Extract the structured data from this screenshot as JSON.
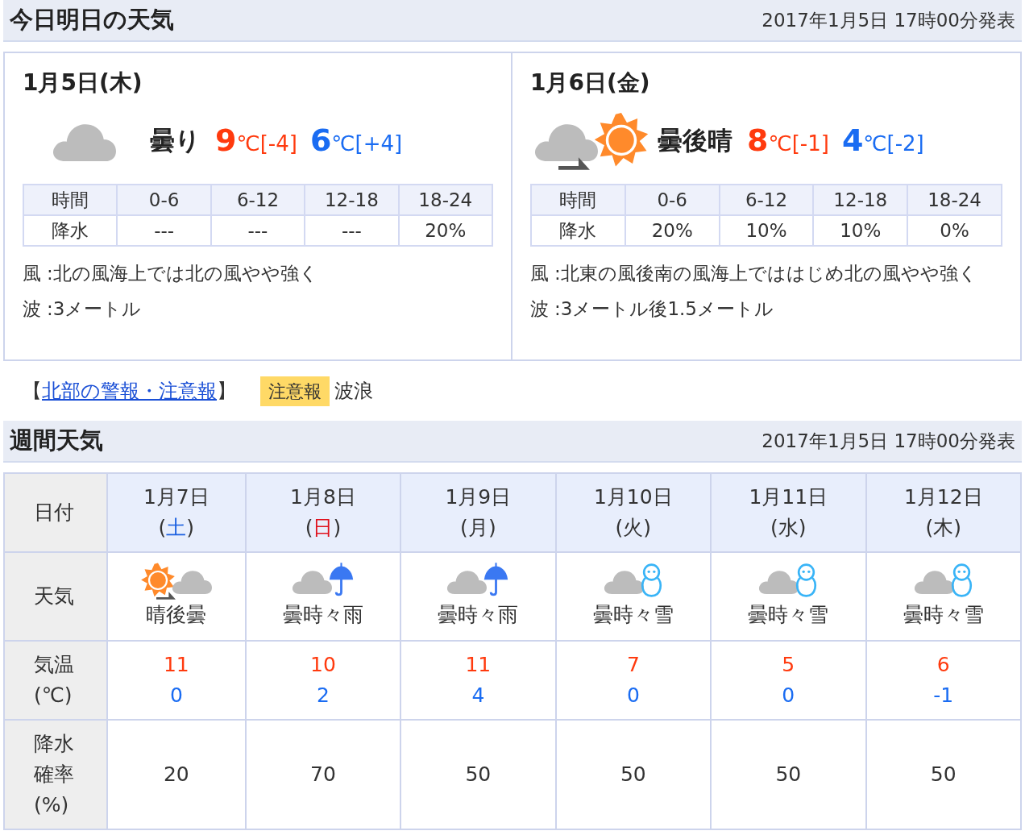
{
  "today_section": {
    "title": "今日明日の天気",
    "issued": "2017年1月5日 17時00分発表",
    "days": [
      {
        "date": "1月5日(木)",
        "icon": {
          "parts": [
            {
              "kind": "cloud"
            }
          ],
          "later": false
        },
        "weather": "曇り",
        "high": {
          "value": "9",
          "unit": "℃",
          "diff": "[-4]"
        },
        "low": {
          "value": "6",
          "unit": "℃",
          "diff": "[+4]"
        },
        "time_header": [
          "時間",
          "0-6",
          "6-12",
          "12-18",
          "18-24"
        ],
        "rain_row": [
          "降水",
          "---",
          "---",
          "---",
          "20%"
        ],
        "notes": [
          {
            "label": "風",
            "text": ":北の風海上では北の風やや強く"
          },
          {
            "label": "波",
            "text": ":3メートル"
          }
        ]
      },
      {
        "date": "1月6日(金)",
        "icon": {
          "parts": [
            {
              "kind": "cloud"
            },
            {
              "kind": "sun"
            }
          ],
          "later": true
        },
        "weather": "曇後晴",
        "high": {
          "value": "8",
          "unit": "℃",
          "diff": "[-1]"
        },
        "low": {
          "value": "4",
          "unit": "℃",
          "diff": "[-2]"
        },
        "time_header": [
          "時間",
          "0-6",
          "6-12",
          "12-18",
          "18-24"
        ],
        "rain_row": [
          "降水",
          "20%",
          "10%",
          "10%",
          "0%"
        ],
        "notes": [
          {
            "label": "風",
            "text": ":北東の風後南の風海上でははじめ北の風やや強く"
          },
          {
            "label": "波",
            "text": ":3メートル後1.5メートル"
          }
        ]
      }
    ]
  },
  "warning": {
    "open": "【",
    "link": "北部の警報・注意報",
    "close": "】",
    "badge": "注意報",
    "item": "波浪"
  },
  "weekly_section": {
    "title": "週間天気",
    "issued": "2017年1月5日 17時00分発表",
    "row_labels": {
      "date": [
        "日付"
      ],
      "weather": [
        "天気"
      ],
      "temp": [
        "気温",
        "(℃)"
      ],
      "rain": [
        "降水",
        "確率",
        "(%)"
      ]
    },
    "days": [
      {
        "date": "1月7日",
        "weekday": {
          "before": "(",
          "day": "土",
          "after": ")",
          "color": "#1a5fe0"
        },
        "icon": {
          "parts": [
            {
              "kind": "sun"
            },
            {
              "kind": "cloud"
            }
          ],
          "later": true
        },
        "weather": "晴後曇",
        "high": "11",
        "low": "0",
        "rain": "20"
      },
      {
        "date": "1月8日",
        "weekday": {
          "before": "(",
          "day": "日",
          "after": ")",
          "color": "#e0101c"
        },
        "icon": {
          "parts": [
            {
              "kind": "cloud"
            },
            {
              "kind": "umbrella"
            }
          ],
          "later": false
        },
        "weather": "曇時々雨",
        "high": "10",
        "low": "2",
        "rain": "70"
      },
      {
        "date": "1月9日",
        "weekday": {
          "before": "(",
          "day": "月",
          "after": ")",
          "color": "#333333"
        },
        "icon": {
          "parts": [
            {
              "kind": "cloud"
            },
            {
              "kind": "umbrella"
            }
          ],
          "later": false
        },
        "weather": "曇時々雨",
        "high": "11",
        "low": "4",
        "rain": "50"
      },
      {
        "date": "1月10日",
        "weekday": {
          "before": "(",
          "day": "火",
          "after": ")",
          "color": "#333333"
        },
        "icon": {
          "parts": [
            {
              "kind": "cloud"
            },
            {
              "kind": "snowman"
            }
          ],
          "later": false
        },
        "weather": "曇時々雪",
        "high": "7",
        "low": "0",
        "rain": "50"
      },
      {
        "date": "1月11日",
        "weekday": {
          "before": "(",
          "day": "水",
          "after": ")",
          "color": "#333333"
        },
        "icon": {
          "parts": [
            {
              "kind": "cloud"
            },
            {
              "kind": "snowman"
            }
          ],
          "later": false
        },
        "weather": "曇時々雪",
        "high": "5",
        "low": "0",
        "rain": "50"
      },
      {
        "date": "1月12日",
        "weekday": {
          "before": "(",
          "day": "木",
          "after": ")",
          "color": "#333333"
        },
        "icon": {
          "parts": [
            {
              "kind": "cloud"
            },
            {
              "kind": "snowman"
            }
          ],
          "later": false
        },
        "weather": "曇時々雪",
        "high": "6",
        "low": "-1",
        "rain": "50"
      }
    ]
  }
}
